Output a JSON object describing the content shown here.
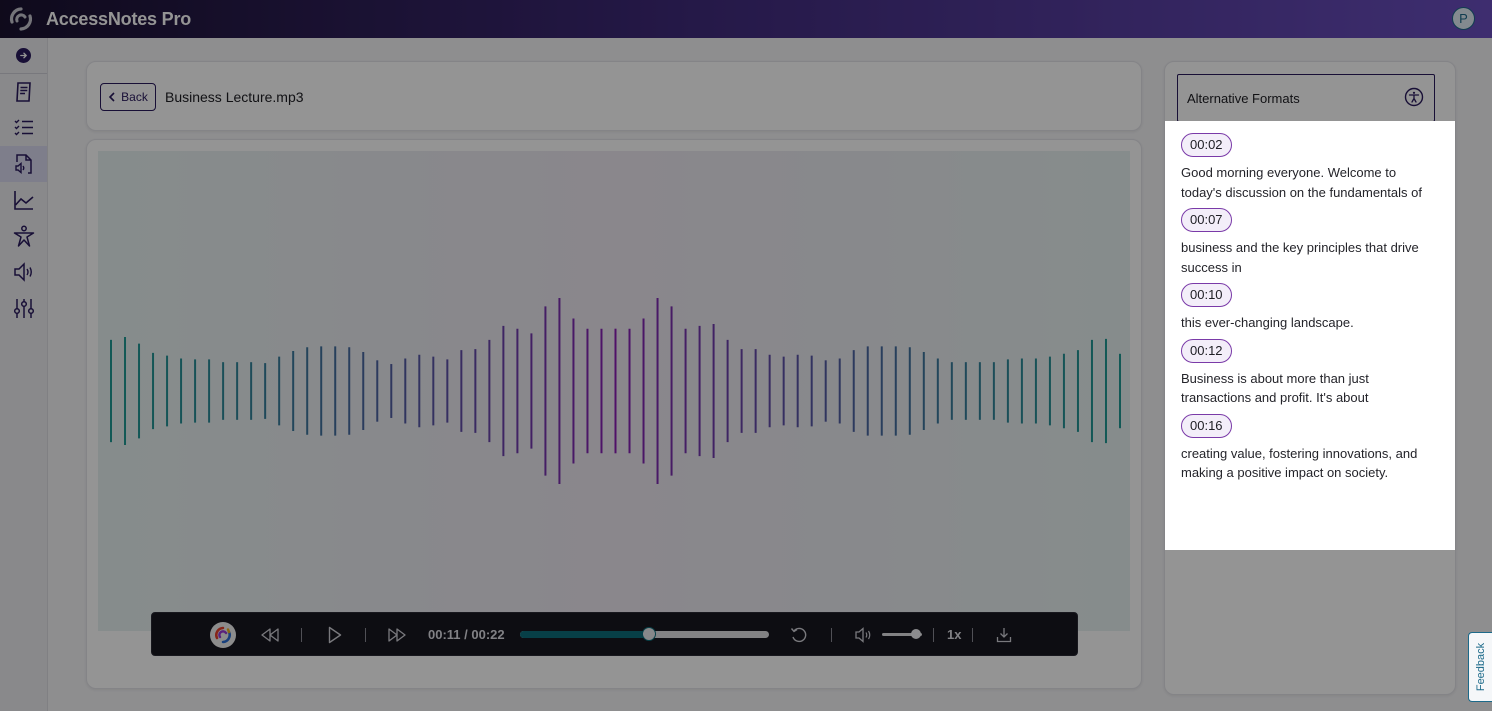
{
  "app": {
    "title": "AccessNotes Pro",
    "avatar_initial": "P"
  },
  "colors": {
    "brand_dark": "#2a1a5e",
    "accent_teal": "#0d6d7a",
    "wave_edge": "#1f9a94",
    "wave_center": "#8a1eb4"
  },
  "sidebar": {
    "items": [
      {
        "name": "notes",
        "icon": "document-icon",
        "active": false
      },
      {
        "name": "checklist",
        "icon": "checklist-icon",
        "active": false
      },
      {
        "name": "audio-file",
        "icon": "audio-file-icon",
        "active": true
      },
      {
        "name": "analytics",
        "icon": "line-chart-icon",
        "active": false
      },
      {
        "name": "accessibility",
        "icon": "accessibility-icon",
        "active": false
      },
      {
        "name": "speaker",
        "icon": "speaker-icon",
        "active": false
      },
      {
        "name": "settings",
        "icon": "sliders-icon",
        "active": false
      }
    ]
  },
  "header": {
    "back_label": "Back",
    "file_name": "Business Lecture.mp3"
  },
  "waveform": {
    "amplitudes": [
      0.55,
      0.58,
      0.51,
      0.41,
      0.38,
      0.35,
      0.34,
      0.34,
      0.31,
      0.31,
      0.31,
      0.3,
      0.37,
      0.43,
      0.47,
      0.48,
      0.48,
      0.47,
      0.42,
      0.33,
      0.29,
      0.35,
      0.39,
      0.37,
      0.34,
      0.44,
      0.45,
      0.55,
      0.7,
      0.67,
      0.62,
      0.91,
      1.0,
      0.78,
      0.67,
      0.67,
      0.67,
      0.67,
      0.78,
      1.0,
      0.91,
      0.67,
      0.7,
      0.72,
      0.55,
      0.45,
      0.45,
      0.39,
      0.37,
      0.39,
      0.38,
      0.33,
      0.35,
      0.44,
      0.48,
      0.48,
      0.48,
      0.47,
      0.42,
      0.35,
      0.31,
      0.31,
      0.31,
      0.31,
      0.34,
      0.35,
      0.35,
      0.37,
      0.4,
      0.44,
      0.55,
      0.56,
      0.4
    ]
  },
  "player": {
    "current_time": "00:11",
    "total_time": "00:22",
    "time_display": "00:11 / 00:22",
    "progress": 0.52,
    "volume": 0.85,
    "speed": "1x"
  },
  "alternative_formats": {
    "title": "Alternative Formats",
    "transcript": [
      {
        "time": "00:02",
        "text": "Good morning everyone. Welcome to today's discussion on the fundamentals of"
      },
      {
        "time": "00:07",
        "text": "business and the key principles that drive success in"
      },
      {
        "time": "00:10",
        "text": "this ever-changing landscape."
      },
      {
        "time": "00:12",
        "text": "Business is about more than just transactions and profit. It's about"
      },
      {
        "time": "00:16",
        "text": "creating value, fostering innovations, and making a positive impact on society."
      }
    ]
  },
  "feedback_label": "Feedback"
}
